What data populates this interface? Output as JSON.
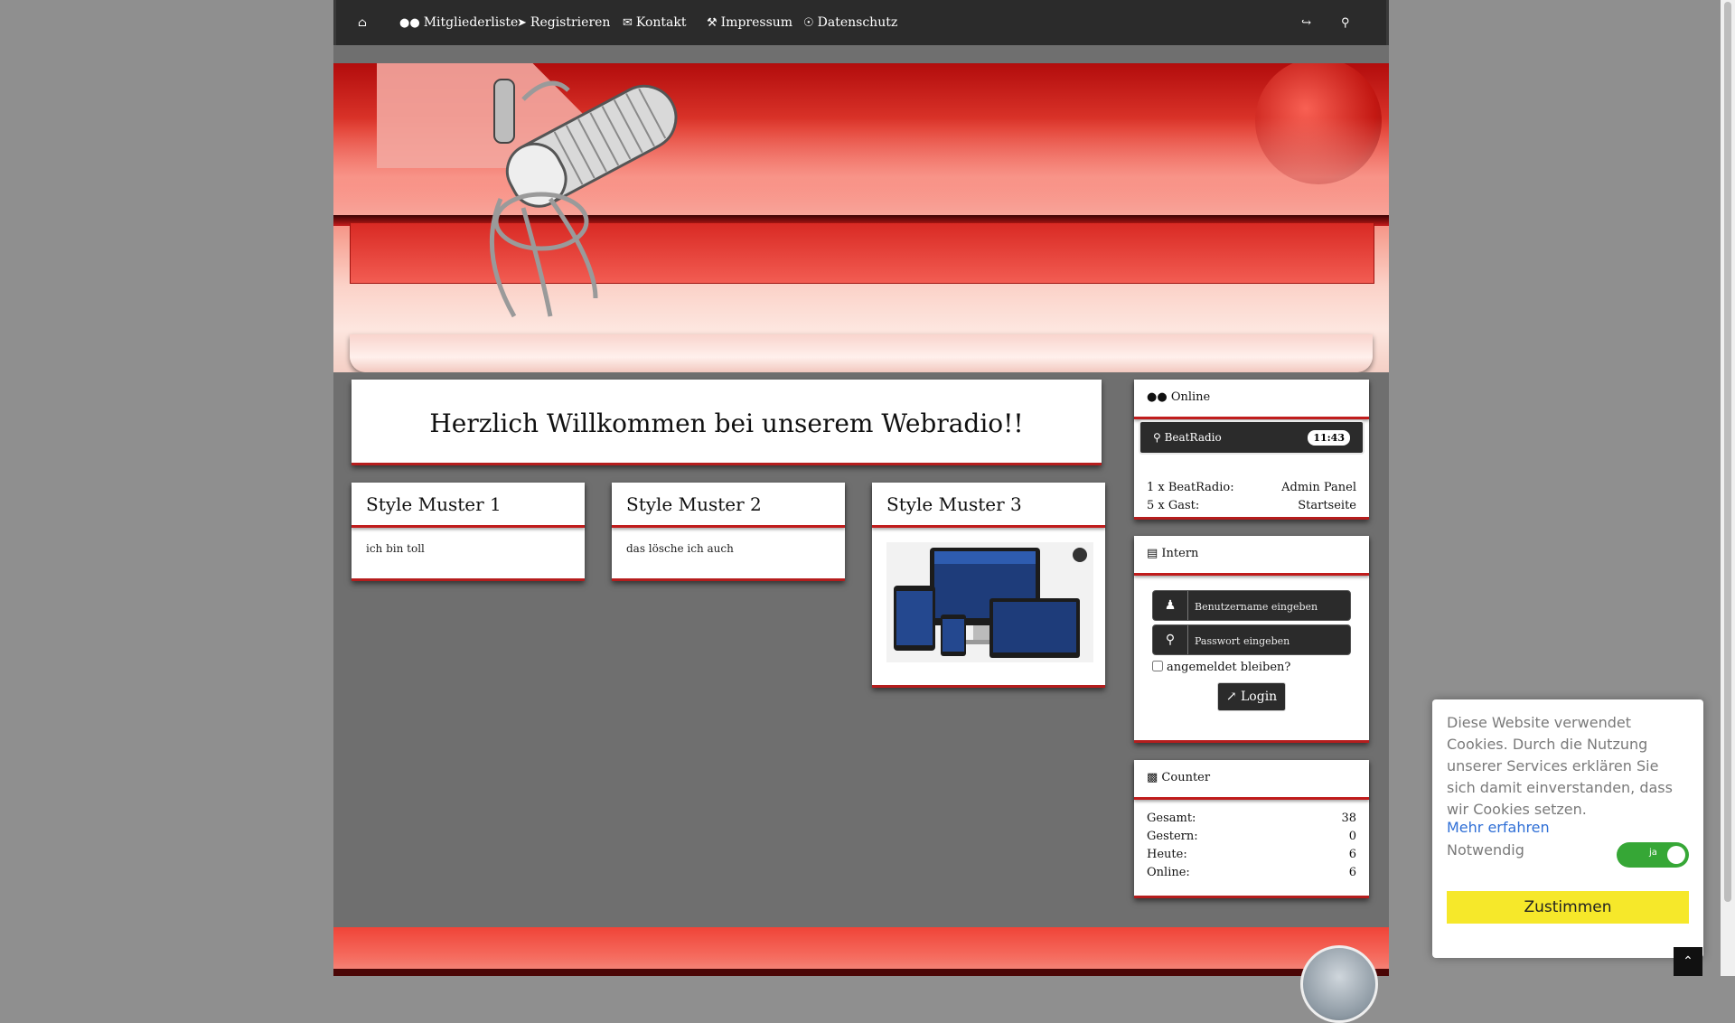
{
  "nav": {
    "items": [
      {
        "icon": "home-icon",
        "label": ""
      },
      {
        "icon": "users-icon",
        "label": "Mitgliederliste"
      },
      {
        "icon": "sign-in-icon",
        "label": "Registrieren"
      },
      {
        "icon": "envelope-icon",
        "label": "Kontakt"
      },
      {
        "icon": "gavel-icon",
        "label": "Impressum"
      },
      {
        "icon": "shield-icon",
        "label": "Datenschutz"
      }
    ],
    "right_icons": [
      "logout-icon",
      "search-icon"
    ]
  },
  "welcome": {
    "title": "Herzlich Willkommen bei unserem Webradio!!"
  },
  "style_boxes": [
    {
      "title": "Style Muster 1",
      "body": "ich bin toll"
    },
    {
      "title": "Style Muster 2",
      "body": "das lösche ich auch"
    },
    {
      "title": "Style Muster 3",
      "body": ""
    }
  ],
  "online": {
    "title": "Online",
    "station": "BeatRadio",
    "time": "11:43",
    "rows": [
      {
        "left": "1 x BeatRadio:",
        "right": "Admin Panel"
      },
      {
        "left": "5 x Gast:",
        "right": "Startseite"
      }
    ]
  },
  "intern": {
    "title": "Intern",
    "username_placeholder": "Benutzername eingeben",
    "password_placeholder": "Passwort eingeben",
    "remember": "angemeldet bleiben?",
    "login": "Login"
  },
  "counter": {
    "title": "Counter",
    "rows": [
      {
        "label": "Gesamt:",
        "value": "38"
      },
      {
        "label": "Gestern:",
        "value": "0"
      },
      {
        "label": "Heute:",
        "value": "6"
      },
      {
        "label": "Online:",
        "value": "6"
      }
    ]
  },
  "cookie": {
    "text": "Diese Website verwendet Cookies. Durch die Nutzung unserer Services erklären Sie sich damit einverstanden, dass wir Cookies setzen.",
    "more": "Mehr erfahren",
    "necessary": "Notwendig",
    "toggle": "ja",
    "accept": "Zustimmen"
  },
  "colors": {
    "accent": "#c01c1c",
    "navbar": "#2b2b2b",
    "cookie_button": "#f6e82a",
    "toggle_on": "#36a736"
  }
}
